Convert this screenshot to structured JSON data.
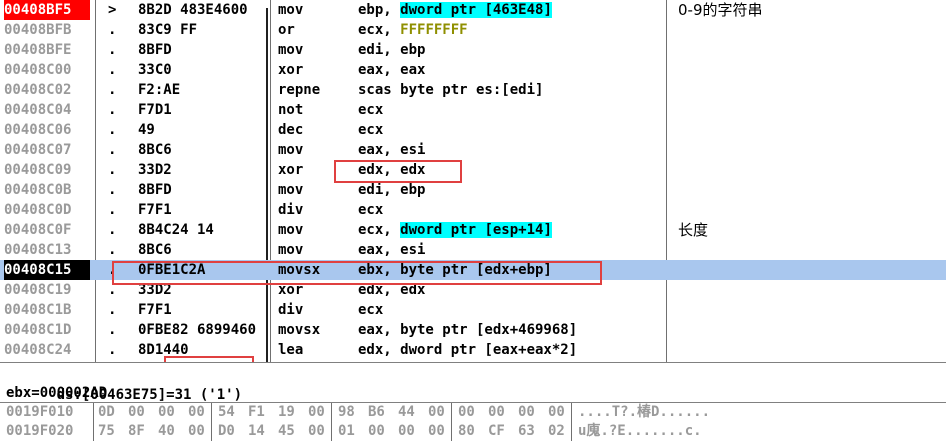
{
  "disassembly": {
    "rows": [
      {
        "address": "00408BF5",
        "marker": ">",
        "hex": "8B2D 483E4600",
        "mnemonic": "mov",
        "operands": "ebp, dword ptr [463E48]",
        "comment": "0-9的字符串"
      },
      {
        "address": "00408BFB",
        "marker": ".",
        "hex": "83C9 FF",
        "mnemonic": "or",
        "operands": "ecx, FFFFFFFF",
        "comment": ""
      },
      {
        "address": "00408BFE",
        "marker": ".",
        "hex": "8BFD",
        "mnemonic": "mov",
        "operands": "edi, ebp",
        "comment": ""
      },
      {
        "address": "00408C00",
        "marker": ".",
        "hex": "33C0",
        "mnemonic": "xor",
        "operands": "eax, eax",
        "comment": ""
      },
      {
        "address": "00408C02",
        "marker": ".",
        "hex": "F2:AE",
        "mnemonic": "repne",
        "operands": "scas byte ptr es:[edi]",
        "comment": ""
      },
      {
        "address": "00408C04",
        "marker": ".",
        "hex": "F7D1",
        "mnemonic": "not",
        "operands": "ecx",
        "comment": ""
      },
      {
        "address": "00408C06",
        "marker": ".",
        "hex": "49",
        "mnemonic": "dec",
        "operands": "ecx",
        "comment": ""
      },
      {
        "address": "00408C07",
        "marker": ".",
        "hex": "8BC6",
        "mnemonic": "mov",
        "operands": "eax, esi",
        "comment": ""
      },
      {
        "address": "00408C09",
        "marker": ".",
        "hex": "33D2",
        "mnemonic": "xor",
        "operands": "edx, edx",
        "comment": ""
      },
      {
        "address": "00408C0B",
        "marker": ".",
        "hex": "8BFD",
        "mnemonic": "mov",
        "operands": "edi, ebp",
        "comment": ""
      },
      {
        "address": "00408C0D",
        "marker": ".",
        "hex": "F7F1",
        "mnemonic": "div",
        "operands": "ecx",
        "comment": ""
      },
      {
        "address": "00408C0F",
        "marker": ".",
        "hex": "8B4C24 14",
        "mnemonic": "mov",
        "operands": "ecx, dword ptr [esp+14]",
        "comment": "长度"
      },
      {
        "address": "00408C13",
        "marker": ".",
        "hex": "8BC6",
        "mnemonic": "mov",
        "operands": "eax, esi",
        "comment": ""
      },
      {
        "address": "00408C15",
        "marker": ".",
        "hex": "0FBE1C2A",
        "mnemonic": "movsx",
        "operands": "ebx, byte ptr [edx+ebp]",
        "comment": ""
      },
      {
        "address": "00408C19",
        "marker": ".",
        "hex": "33D2",
        "mnemonic": "xor",
        "operands": "edx, edx",
        "comment": ""
      },
      {
        "address": "00408C1B",
        "marker": ".",
        "hex": "F7F1",
        "mnemonic": "div",
        "operands": "ecx",
        "comment": ""
      },
      {
        "address": "00408C1D",
        "marker": ".",
        "hex": "0FBE82 6899460",
        "mnemonic": "movsx",
        "operands": "eax, byte ptr [edx+469968]",
        "comment": ""
      },
      {
        "address": "00408C24",
        "marker": ".",
        "hex": "8D1440",
        "mnemonic": "lea",
        "operands": "edx, dword ptr [eax+eax*2]",
        "comment": ""
      }
    ]
  },
  "info": {
    "line1_prefix": "ds:[00463E75]=31",
    "line1_char": "('1')",
    "line2": "ebx=000002AD"
  },
  "dump": {
    "rows": [
      {
        "address": "0019F010",
        "bytes": [
          "0D",
          "00",
          "00",
          "00",
          "54",
          "F1",
          "19",
          "00",
          "98",
          "B6",
          "44",
          "00",
          "00",
          "00",
          "00",
          "00"
        ],
        "ascii": "....T?.椿D......"
      },
      {
        "address": "0019F020",
        "bytes": [
          "75",
          "8F",
          "40",
          "00",
          "D0",
          "14",
          "45",
          "00",
          "01",
          "00",
          "00",
          "00",
          "80",
          "CF",
          "63",
          "02"
        ],
        "ascii": "u廆.?E.......c."
      }
    ]
  },
  "colors": {
    "selected_row": "#a9c7ee",
    "cyan_highlight": "#00ffff",
    "annotation_box": "#e04040",
    "eip_marker": "#ff0000"
  }
}
